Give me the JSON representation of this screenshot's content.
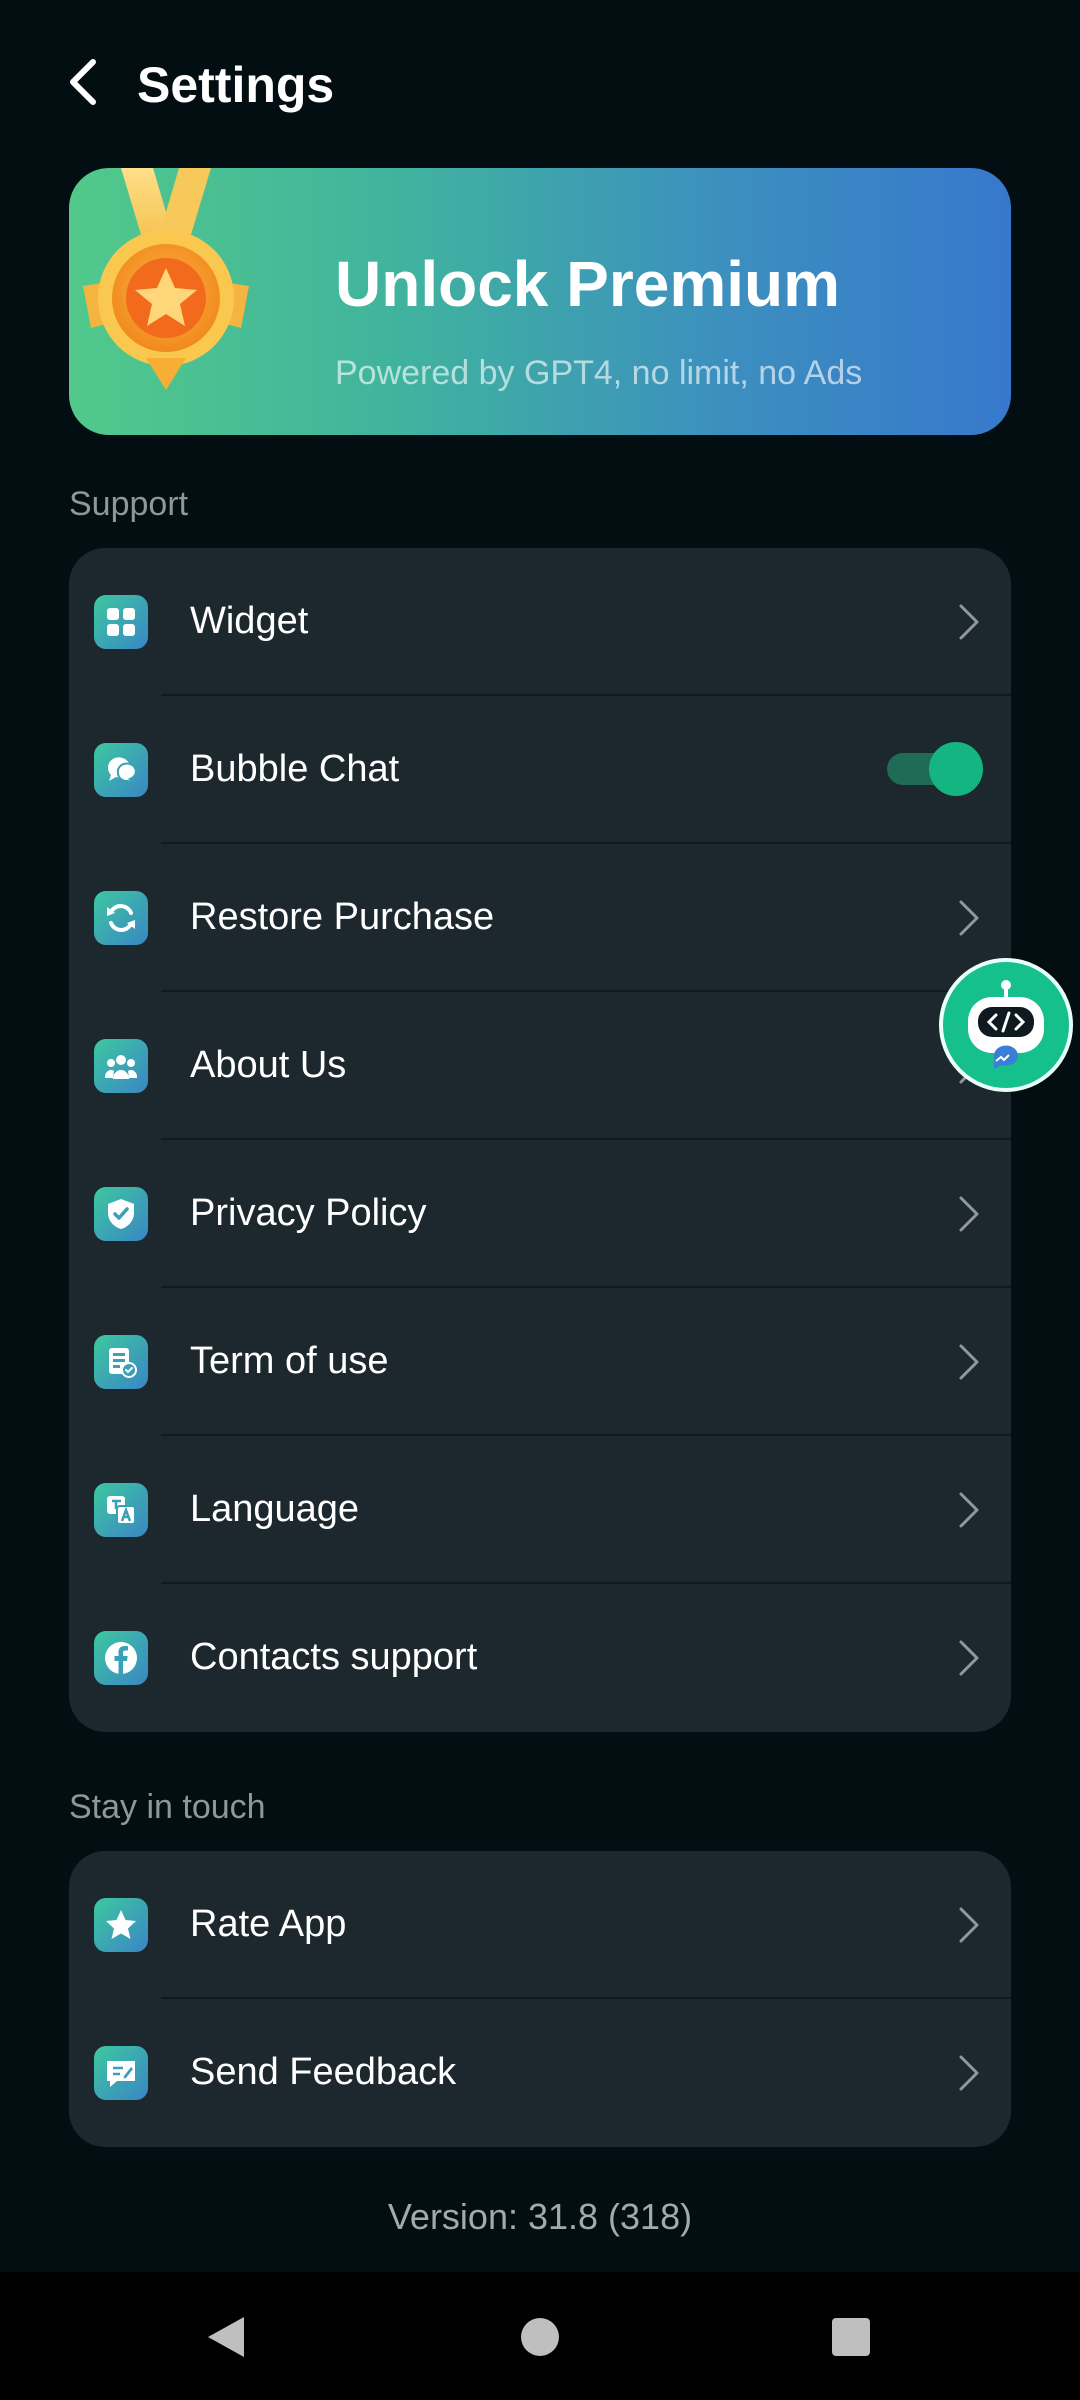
{
  "header": {
    "title": "Settings",
    "back_icon": "back-arrow-icon"
  },
  "premium": {
    "title": "Unlock Premium",
    "subtitle": "Powered by GPT4, no limit, no Ads",
    "icon": "medal-icon"
  },
  "support": {
    "label": "Support",
    "items": [
      {
        "label": "Widget",
        "icon": "widget-icon",
        "control": "chevron"
      },
      {
        "label": "Bubble Chat",
        "icon": "bubble-chat-icon",
        "control": "toggle",
        "enabled": true
      },
      {
        "label": "Restore Purchase",
        "icon": "restore-icon",
        "control": "chevron"
      },
      {
        "label": "About Us",
        "icon": "people-icon",
        "control": "chevron"
      },
      {
        "label": "Privacy Policy",
        "icon": "shield-icon",
        "control": "chevron"
      },
      {
        "label": "Term of use",
        "icon": "document-icon",
        "control": "chevron"
      },
      {
        "label": "Language",
        "icon": "translate-icon",
        "control": "chevron"
      },
      {
        "label": "Contacts support",
        "icon": "facebook-icon",
        "control": "chevron"
      }
    ]
  },
  "stay_in_touch": {
    "label": "Stay in touch",
    "items": [
      {
        "label": "Rate App",
        "icon": "star-icon",
        "control": "chevron"
      },
      {
        "label": "Send Feedback",
        "icon": "feedback-icon",
        "control": "chevron"
      }
    ]
  },
  "version": "Version: 31.8 (318)",
  "colors": {
    "background": "#030e12",
    "card": "#1d282e",
    "accent": "#15b582",
    "premium_start": "#52c98a",
    "premium_end": "#3778cc"
  }
}
